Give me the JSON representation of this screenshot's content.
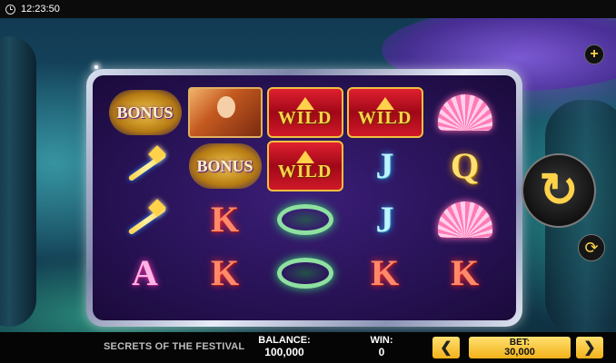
{
  "status_bar": {
    "time": "12:23:50"
  },
  "reels": [
    [
      "bonus",
      "lady",
      "wild",
      "wild",
      "fan"
    ],
    [
      "key",
      "bonus",
      "wild",
      "J",
      "Q"
    ],
    [
      "key",
      "K",
      "tiara",
      "J",
      "fan"
    ],
    [
      "A",
      "K",
      "tiara",
      "K",
      "K"
    ]
  ],
  "labels": {
    "wild": "WILD",
    "bonus": "BONUS"
  },
  "footer": {
    "game_name": "SECRETS OF THE FESTIVAL",
    "balance_label": "BALANCE:",
    "balance_value": "100,000",
    "win_label": "WIN:",
    "win_value": "0",
    "bet_label": "BET:",
    "bet_value": "30,000",
    "prev_symbol": "❮",
    "next_symbol": "❯"
  },
  "controls": {
    "plus_symbol": "+",
    "spin_symbol": "↻",
    "autoplay_symbol": "⟳"
  }
}
